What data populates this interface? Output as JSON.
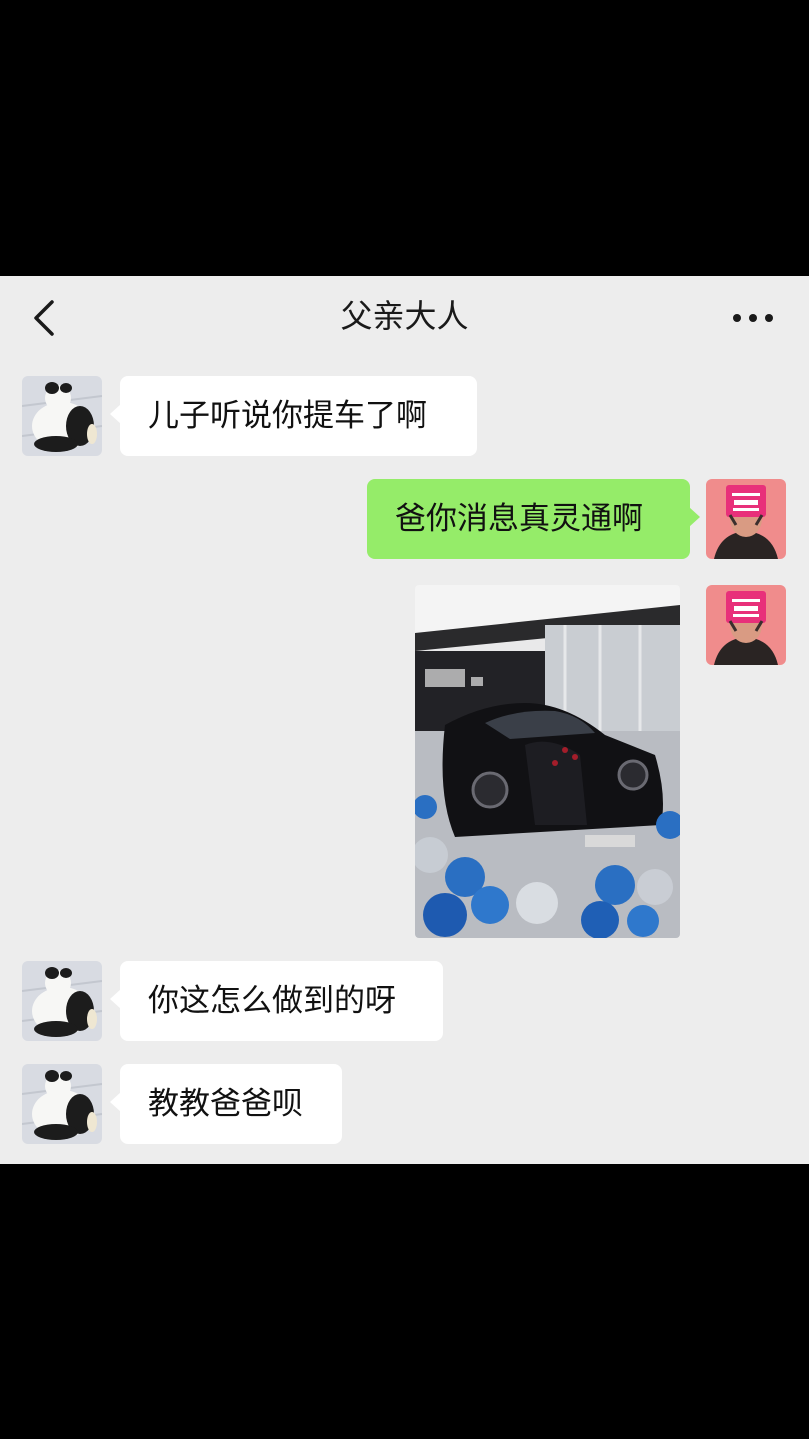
{
  "header": {
    "title": "父亲大人",
    "back_icon": "chevron-left-icon",
    "more_icon": "more-dots-icon"
  },
  "messages": [
    {
      "from": "father",
      "text": "儿子听说你提车了啊"
    },
    {
      "from": "me",
      "text": "爸你消息真灵通啊"
    },
    {
      "from": "me",
      "type": "image",
      "image": "black sports car with balloons in showroom"
    },
    {
      "from": "father",
      "text": "你这怎么做到的呀"
    },
    {
      "from": "father",
      "text": "教教爸爸呗"
    }
  ],
  "colors": {
    "chat_background": "#ededed",
    "incoming_bubble": "#ffffff",
    "outgoing_bubble": "#95ec69",
    "letterbox": "#000000"
  }
}
